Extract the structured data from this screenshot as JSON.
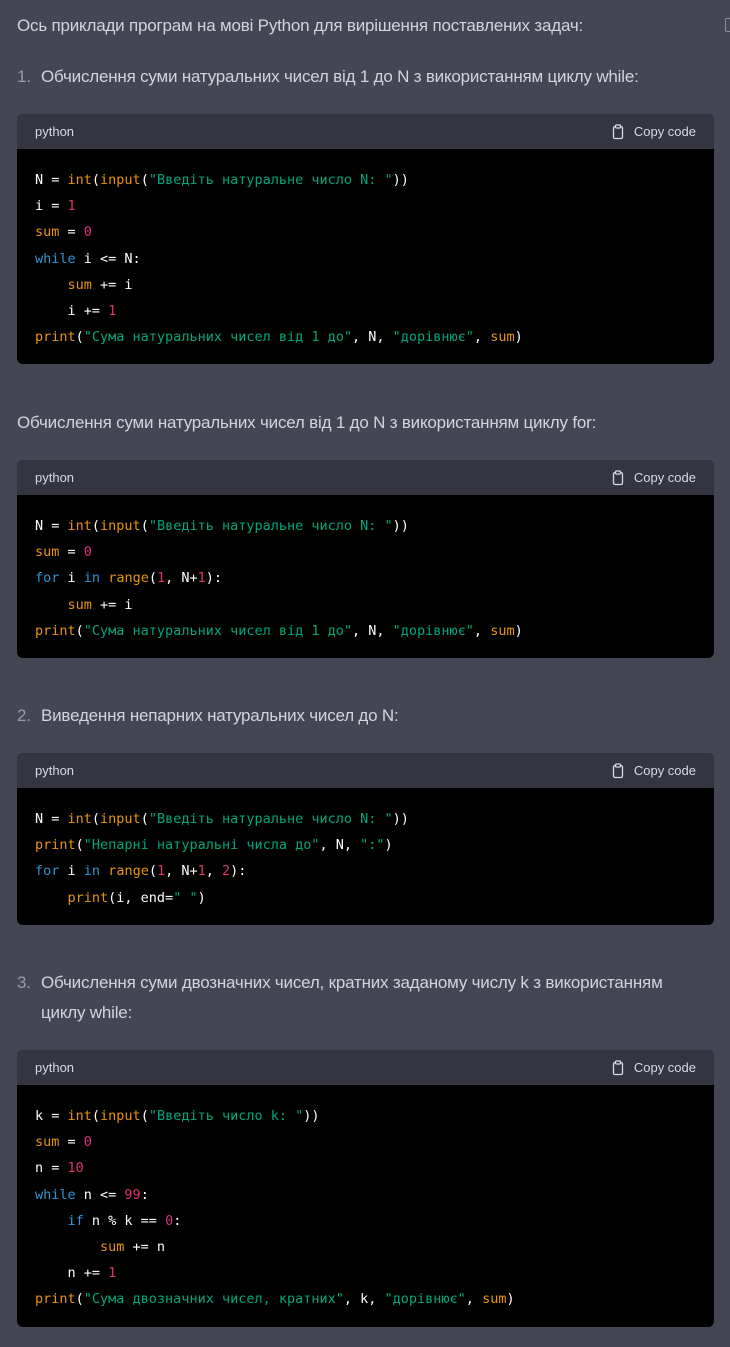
{
  "intro": "Ось приклади програм на мові Python для вирішення поставлених задач:",
  "sections": [
    {
      "number": "1.",
      "heading": "Обчислення суми натуральних чисел від 1 до N з використанням циклу while:"
    },
    {
      "number": "",
      "heading": "Обчислення суми натуральних чисел від 1 до N з використанням циклу for:"
    },
    {
      "number": "2.",
      "heading": "Виведення непарних натуральних чисел до N:"
    },
    {
      "number": "3.",
      "heading": "Обчислення суми двозначних чисел, кратних заданому числу k з використанням циклу while:"
    }
  ],
  "code_blocks": [
    {
      "language": "python",
      "copy_label": "Copy code",
      "lines": [
        [
          [
            "t",
            "N = "
          ],
          [
            "fn",
            "int"
          ],
          [
            "t",
            "("
          ],
          [
            "fn",
            "input"
          ],
          [
            "t",
            "("
          ],
          [
            "str",
            "\"Введіть натуральне число N: \""
          ],
          [
            "t",
            "))"
          ]
        ],
        [
          [
            "t",
            "i = "
          ],
          [
            "num",
            "1"
          ]
        ],
        [
          [
            "var",
            "sum"
          ],
          [
            "t",
            " = "
          ],
          [
            "num",
            "0"
          ]
        ],
        [
          [
            "kw",
            "while"
          ],
          [
            "t",
            " i <= N:"
          ]
        ],
        [
          [
            "t",
            "    "
          ],
          [
            "var",
            "sum"
          ],
          [
            "t",
            " += i"
          ]
        ],
        [
          [
            "t",
            "    i += "
          ],
          [
            "num",
            "1"
          ]
        ],
        [
          [
            "fn",
            "print"
          ],
          [
            "t",
            "("
          ],
          [
            "str",
            "\"Сума натуральних чисел від 1 до\""
          ],
          [
            "t",
            ", N, "
          ],
          [
            "str",
            "\"дорівнює\""
          ],
          [
            "t",
            ", "
          ],
          [
            "var",
            "sum"
          ],
          [
            "t",
            ")"
          ]
        ]
      ]
    },
    {
      "language": "python",
      "copy_label": "Copy code",
      "lines": [
        [
          [
            "t",
            "N = "
          ],
          [
            "fn",
            "int"
          ],
          [
            "t",
            "("
          ],
          [
            "fn",
            "input"
          ],
          [
            "t",
            "("
          ],
          [
            "str",
            "\"Введіть натуральне число N: \""
          ],
          [
            "t",
            "))"
          ]
        ],
        [
          [
            "var",
            "sum"
          ],
          [
            "t",
            " = "
          ],
          [
            "num",
            "0"
          ]
        ],
        [
          [
            "kw",
            "for"
          ],
          [
            "t",
            " i "
          ],
          [
            "kw",
            "in"
          ],
          [
            "t",
            " "
          ],
          [
            "fn",
            "range"
          ],
          [
            "t",
            "("
          ],
          [
            "num",
            "1"
          ],
          [
            "t",
            ", N+"
          ],
          [
            "num",
            "1"
          ],
          [
            "t",
            "):"
          ]
        ],
        [
          [
            "t",
            "    "
          ],
          [
            "var",
            "sum"
          ],
          [
            "t",
            " += i"
          ]
        ],
        [
          [
            "fn",
            "print"
          ],
          [
            "t",
            "("
          ],
          [
            "str",
            "\"Сума натуральних чисел від 1 до\""
          ],
          [
            "t",
            ", N, "
          ],
          [
            "str",
            "\"дорівнює\""
          ],
          [
            "t",
            ", "
          ],
          [
            "var",
            "sum"
          ],
          [
            "t",
            ")"
          ]
        ]
      ]
    },
    {
      "language": "python",
      "copy_label": "Copy code",
      "lines": [
        [
          [
            "t",
            "N = "
          ],
          [
            "fn",
            "int"
          ],
          [
            "t",
            "("
          ],
          [
            "fn",
            "input"
          ],
          [
            "t",
            "("
          ],
          [
            "str",
            "\"Введіть натуральне число N: \""
          ],
          [
            "t",
            "))"
          ]
        ],
        [
          [
            "fn",
            "print"
          ],
          [
            "t",
            "("
          ],
          [
            "str",
            "\"Непарні натуральні числа до\""
          ],
          [
            "t",
            ", N, "
          ],
          [
            "str",
            "\":\""
          ],
          [
            "t",
            ")"
          ]
        ],
        [
          [
            "kw",
            "for"
          ],
          [
            "t",
            " i "
          ],
          [
            "kw",
            "in"
          ],
          [
            "t",
            " "
          ],
          [
            "fn",
            "range"
          ],
          [
            "t",
            "("
          ],
          [
            "num",
            "1"
          ],
          [
            "t",
            ", N+"
          ],
          [
            "num",
            "1"
          ],
          [
            "t",
            ", "
          ],
          [
            "num",
            "2"
          ],
          [
            "t",
            "):"
          ]
        ],
        [
          [
            "t",
            "    "
          ],
          [
            "fn",
            "print"
          ],
          [
            "t",
            "(i, end="
          ],
          [
            "str",
            "\" \""
          ],
          [
            "t",
            ")"
          ]
        ]
      ]
    },
    {
      "language": "python",
      "copy_label": "Copy code",
      "lines": [
        [
          [
            "t",
            "k = "
          ],
          [
            "fn",
            "int"
          ],
          [
            "t",
            "("
          ],
          [
            "fn",
            "input"
          ],
          [
            "t",
            "("
          ],
          [
            "str",
            "\"Введіть число k: \""
          ],
          [
            "t",
            "))"
          ]
        ],
        [
          [
            "var",
            "sum"
          ],
          [
            "t",
            " = "
          ],
          [
            "num",
            "0"
          ]
        ],
        [
          [
            "t",
            "n = "
          ],
          [
            "num",
            "10"
          ]
        ],
        [
          [
            "kw",
            "while"
          ],
          [
            "t",
            " n <= "
          ],
          [
            "num",
            "99"
          ],
          [
            "t",
            ":"
          ]
        ],
        [
          [
            "t",
            "    "
          ],
          [
            "kw",
            "if"
          ],
          [
            "t",
            " n % k == "
          ],
          [
            "num",
            "0"
          ],
          [
            "t",
            ":"
          ]
        ],
        [
          [
            "t",
            "        "
          ],
          [
            "var",
            "sum"
          ],
          [
            "t",
            " += n"
          ]
        ],
        [
          [
            "t",
            "    n += "
          ],
          [
            "num",
            "1"
          ]
        ],
        [
          [
            "fn",
            "print"
          ],
          [
            "t",
            "("
          ],
          [
            "str",
            "\"Сума двозначних чисел, кратних\""
          ],
          [
            "t",
            ", k, "
          ],
          [
            "str",
            "\"дорівнює\""
          ],
          [
            "t",
            ", "
          ],
          [
            "var",
            "sum"
          ],
          [
            "t",
            ")"
          ]
        ]
      ]
    }
  ]
}
